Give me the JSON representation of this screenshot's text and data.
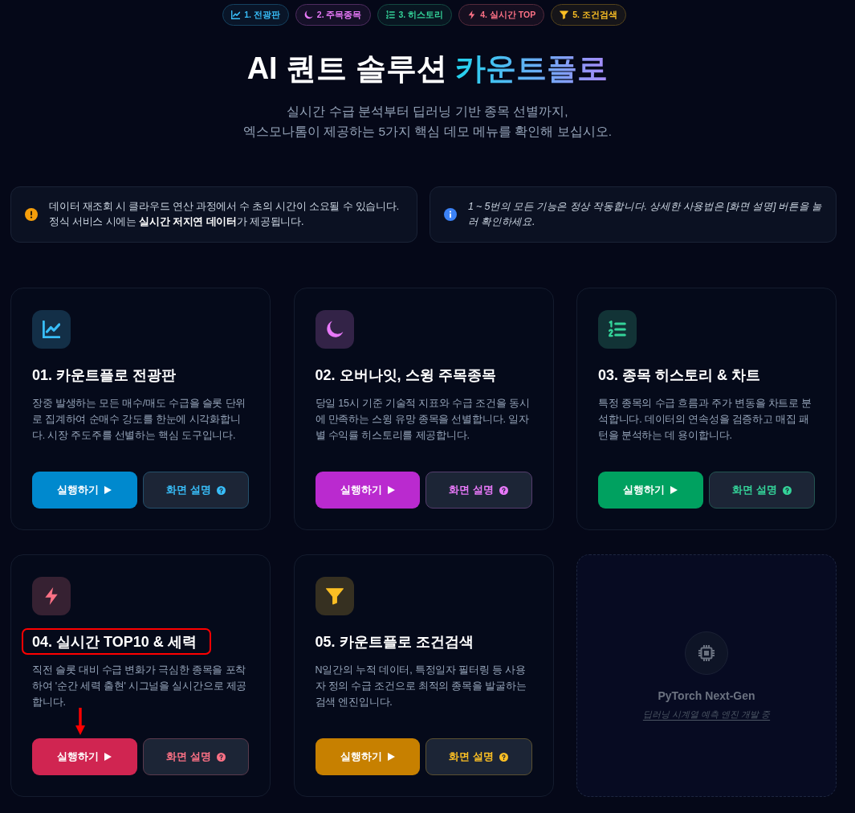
{
  "nav": [
    {
      "label": "1. 전광판",
      "color": "#38bdf8"
    },
    {
      "label": "2. 주목종목",
      "color": "#e879f9"
    },
    {
      "label": "3. 히스토리",
      "color": "#34d399"
    },
    {
      "label": "4. 실시간 TOP",
      "color": "#fb7185"
    },
    {
      "label": "5. 조건검색",
      "color": "#fbbf24"
    }
  ],
  "hero": {
    "title": "AI 퀀트 솔루션",
    "highlight": "카운트플로",
    "subtitle": [
      "실시간 수급 분석부터 딥러닝 기반 종목 선별까지,",
      "엑스모나톰이 제공하는 5가지 핵심 데모 메뉴를 확인해 보십시오."
    ]
  },
  "notices": [
    {
      "kind": "warning",
      "text": "데이터 재조회 시 클라우드 연산 과정에서 수 초의 시간이 소요될 수 있습니다. 정식 서비스 시에는 **실시간 저지연 데이터**가 제공됩니다."
    },
    {
      "kind": "info",
      "text": "1 ~ 5번의 모든 기능은 정상 작동합니다. 상세한 사용법은 [화면 설명] 버튼을 눌러 확인하세요."
    }
  ],
  "cards": [
    {
      "kind": "feature",
      "title": "01. 카운트플로 전광판",
      "description": "장중 발생하는 모든 매수/매도 수급을 슬롯 단위로 집계하여 순매수 강도를 한눈에 시각화합니다. 시장 주도주를 선별하는 핵심 도구입니다.",
      "color": "#38bdf8",
      "run_label": "실행하기",
      "help_label": "화면 설명",
      "callout": false,
      "pointer": false
    },
    {
      "kind": "feature",
      "title": "02. 오버나잇, 스윙 주목종목",
      "description": "당일 15시 기준 기술적 지표와 수급 조건을 동시에 만족하는 스윙 유망 종목을 선별합니다. 일자별 수익률 히스토리를 제공합니다.",
      "color": "#e879f9",
      "run_label": "실행하기",
      "help_label": "화면 설명",
      "callout": false,
      "pointer": false
    },
    {
      "kind": "feature",
      "title": "03. 종목 히스토리 & 차트",
      "description": "특정 종목의 수급 흐름과 주가 변동을 차트로 분석합니다. 데이터의 연속성을 검증하고 매집 패턴을 분석하는 데 용이합니다.",
      "color": "#34d399",
      "run_label": "실행하기",
      "help_label": "화면 설명",
      "callout": false,
      "pointer": false
    },
    {
      "kind": "feature",
      "title": "04. 실시간 TOP10 & 세력",
      "description": "직전 슬롯 대비 수급 변화가 극심한 종목을 포착하여 '순간 세력 출현' 시그널을 실시간으로 제공합니다.",
      "color": "#fb7185",
      "run_label": "실행하기",
      "help_label": "화면 설명",
      "callout": true,
      "pointer": true
    },
    {
      "kind": "feature",
      "title": "05. 카운트플로 조건검색",
      "description": "N일간의 누적 데이터, 특정일자 필터링 등 사용자 정의 수급 조건으로 최적의 종목을 발굴하는 검색 엔진입니다.",
      "color": "#fbbf24",
      "run_label": "실행하기",
      "help_label": "화면 설명",
      "callout": false,
      "pointer": false
    },
    {
      "kind": "upcoming",
      "title": "PyTorch Next-Gen",
      "description": "딥러닝 시계열 예측 엔진 개발 중"
    }
  ]
}
